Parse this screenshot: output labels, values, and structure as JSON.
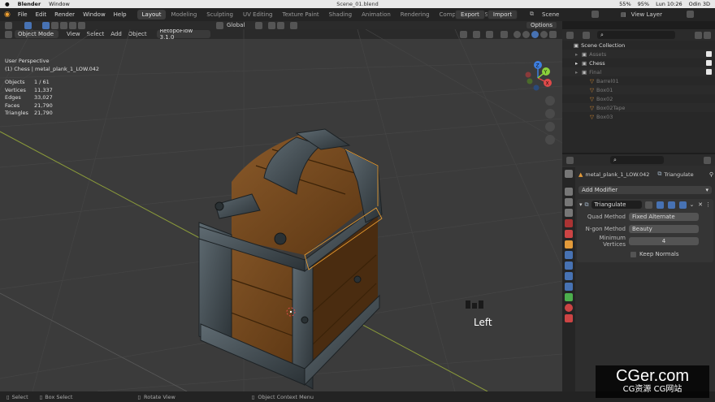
{
  "macos": {
    "apple": "",
    "app": "Blender",
    "window_menu": "Window",
    "title": "Scene_01.blend",
    "battery": "95%",
    "cpu": "55%",
    "clock": "Lun 10:26",
    "user": "Odin 3D"
  },
  "blender_menu": [
    "File",
    "Edit",
    "Render",
    "Window",
    "Help"
  ],
  "workspaces": [
    "Layout",
    "Modeling",
    "Sculpting",
    "UV Editing",
    "Texture Paint",
    "Shading",
    "Animation",
    "Rendering",
    "Compositing",
    "Scripting"
  ],
  "active_workspace": "Layout",
  "top_right": {
    "export": "Export",
    "import": "Import",
    "scene": "Scene",
    "view_layer": "View Layer"
  },
  "viewport_header": {
    "mode": "Object Mode",
    "menus": [
      "View",
      "Select",
      "Add",
      "Object"
    ],
    "addon": "RetopoFlow 3.1.0",
    "transform": "Global",
    "options": "Options"
  },
  "viewport_info": {
    "perspective": "User Perspective",
    "object": "(1) Chess | metal_plank_1_LOW.042",
    "stats": [
      {
        "label": "Objects",
        "value": "1 / 61"
      },
      {
        "label": "Vertices",
        "value": "11,337"
      },
      {
        "label": "Edges",
        "value": "33,027"
      },
      {
        "label": "Faces",
        "value": "21,790"
      },
      {
        "label": "Triangles",
        "value": "21,790"
      }
    ]
  },
  "gizmo": {
    "x": "X",
    "y": "Y",
    "z": "Z"
  },
  "key_overlay": "Left",
  "outliner": {
    "search_placeholder": "",
    "root": "Scene Collection",
    "items": [
      {
        "label": "Assets",
        "indent": 1,
        "checked": true,
        "dim": true
      },
      {
        "label": "Chess",
        "indent": 1,
        "checked": true,
        "dim": false
      },
      {
        "label": "Final",
        "indent": 1,
        "checked": true,
        "dim": true
      },
      {
        "label": "Barrel01",
        "indent": 2,
        "checked": false,
        "dim": true
      },
      {
        "label": "Box01",
        "indent": 2,
        "checked": false,
        "dim": true
      },
      {
        "label": "Box02",
        "indent": 2,
        "checked": false,
        "dim": true
      },
      {
        "label": "Box02Tape",
        "indent": 2,
        "checked": false,
        "dim": true
      },
      {
        "label": "Box03",
        "indent": 2,
        "checked": false,
        "dim": true
      }
    ]
  },
  "properties": {
    "object_name": "metal_plank_1_LOW.042",
    "modifier_tab": "Triangulate",
    "add_modifier": "Add Modifier",
    "modifier_name": "Triangulate",
    "fields": [
      {
        "label": "Quad Method",
        "value": "Fixed Alternate",
        "kind": "dropdown"
      },
      {
        "label": "N-gon Method",
        "value": "Beauty",
        "kind": "dropdown"
      },
      {
        "label": "Minimum Vertices",
        "value": "4",
        "kind": "number"
      }
    ],
    "keep_normals": "Keep Normals"
  },
  "statusbar": [
    "Select",
    "Box Select",
    "Rotate View",
    "Object Context Menu"
  ],
  "watermark": {
    "line1": "CGer.com",
    "line2": "CG资源 CG网站"
  },
  "colors": {
    "viewport_bg": "#3b3b3b",
    "accent_blue": "#4772b3",
    "x_axis": "#e04a4a",
    "y_axis": "#8bd13b",
    "z_axis": "#3d7ee0",
    "selection": "#f0a030"
  }
}
